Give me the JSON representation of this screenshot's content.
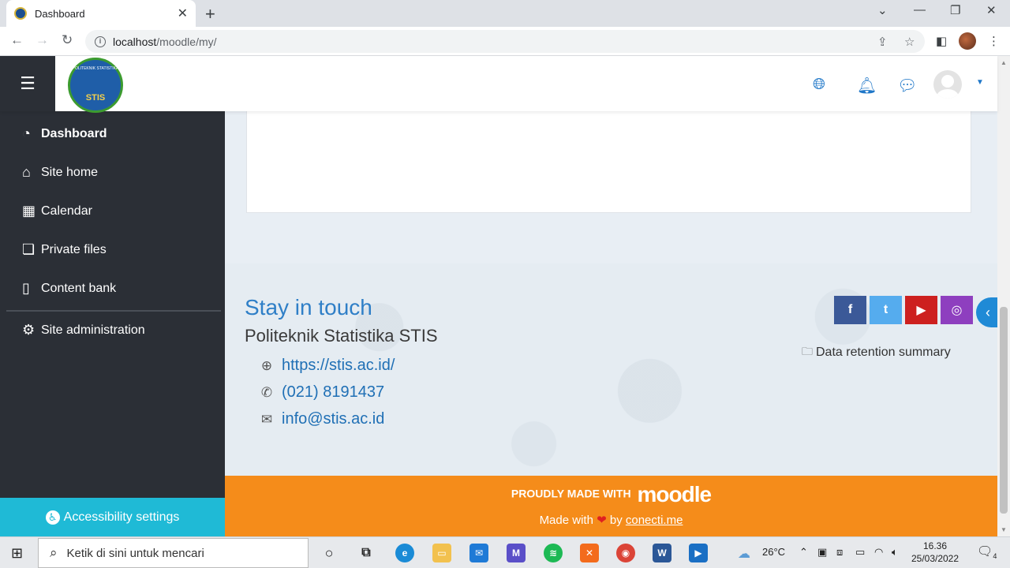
{
  "browser": {
    "tab_title": "Dashboard",
    "url_host": "localhost",
    "url_path": "/moodle/my/"
  },
  "logo": {
    "text": "STIS",
    "arc_text": "POLITEKNIK STATISTIKA"
  },
  "sidebar": {
    "items": [
      {
        "label": "Dashboard",
        "icon": "dashboard-icon",
        "active": true
      },
      {
        "label": "Site home",
        "icon": "home-icon"
      },
      {
        "label": "Calendar",
        "icon": "calendar-icon"
      },
      {
        "label": "Private files",
        "icon": "file-icon"
      },
      {
        "label": "Content bank",
        "icon": "clipboard-icon"
      }
    ],
    "admin_label": "Site administration",
    "accessibility_label": "Accessibility settings"
  },
  "footer": {
    "stay_in_touch": "Stay in touch",
    "org": "Politeknik Statistika STIS",
    "website": "https://stis.ac.id/",
    "phone": "(021) 8191437",
    "email": "info@stis.ac.id",
    "data_retention": "Data retention summary",
    "social": [
      {
        "name": "facebook",
        "glyph": "f",
        "color": "#3b5998"
      },
      {
        "name": "twitter",
        "glyph": "t",
        "color": "#55acee"
      },
      {
        "name": "youtube",
        "glyph": "▶",
        "color": "#cd201f"
      },
      {
        "name": "instagram",
        "glyph": "◎",
        "color": "#8e3fbf"
      }
    ],
    "made_with": "PROUDLY MADE WITH",
    "moodle": "moodle",
    "made_by_prefix": "Made with",
    "made_by_mid": "by",
    "made_by_link": "conecti.me"
  },
  "taskbar": {
    "search_placeholder": "Ketik di sini untuk mencari",
    "temperature": "26°C",
    "time": "16.36",
    "date": "25/03/2022",
    "notification_count": "4"
  },
  "colors": {
    "sidebar_bg": "#2b2f36",
    "accent": "#1f77c8",
    "footer_orange": "#f58c1a",
    "accessibility_bg": "#1fbad6"
  }
}
